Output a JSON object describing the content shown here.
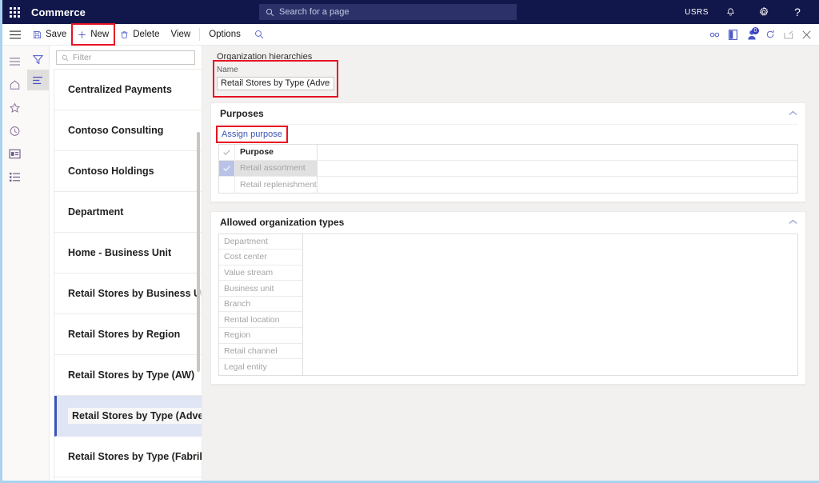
{
  "topbar": {
    "app_name": "Commerce",
    "search_placeholder": "Search for a page",
    "search_value": "",
    "waffle_icon": "app-launcher-icon",
    "search_icon": "search-icon",
    "user_initials": "USRS",
    "notifications_icon": "bell-icon",
    "settings_icon": "gear-icon",
    "help_icon": "help-icon"
  },
  "commandbar": {
    "menu_icon": "hamburger-menu-icon",
    "items": [
      {
        "label": "Save",
        "icon": "save-icon",
        "highlighted": false
      },
      {
        "label": "New",
        "icon": "plus-icon",
        "highlighted": true
      },
      {
        "label": "Delete",
        "icon": "trash-icon",
        "highlighted": false
      },
      {
        "label": "View",
        "icon": "",
        "highlighted": false
      },
      {
        "label": "Options",
        "icon": "",
        "highlighted": false
      }
    ],
    "search_icon": "search-icon",
    "right_icons": [
      {
        "name": "attach-link-icon",
        "badge": ""
      },
      {
        "name": "office-app-icon",
        "badge": ""
      },
      {
        "name": "user-presence-icon",
        "badge": "0"
      },
      {
        "name": "refresh-icon",
        "badge": ""
      },
      {
        "name": "popout-icon",
        "badge": ""
      },
      {
        "name": "close-icon",
        "badge": ""
      }
    ]
  },
  "rail": {
    "items": [
      {
        "name": "navigation-menu-icon",
        "selected": false
      },
      {
        "name": "home-icon",
        "selected": false
      },
      {
        "name": "favorites-star-icon",
        "selected": false
      },
      {
        "name": "recent-clock-icon",
        "selected": false
      },
      {
        "name": "workspaces-icon",
        "selected": false
      },
      {
        "name": "modules-list-icon",
        "selected": false
      }
    ],
    "filter_rail": [
      {
        "name": "filter-funnel-icon",
        "selected": false
      },
      {
        "name": "list-view-icon",
        "selected": true
      }
    ]
  },
  "listpane": {
    "filter_placeholder": "Filter",
    "filter_value": "",
    "filter_icon": "search-icon",
    "items": [
      {
        "label": "Centralized Payments",
        "selected": false
      },
      {
        "label": "Contoso Consulting",
        "selected": false
      },
      {
        "label": "Contoso Holdings",
        "selected": false
      },
      {
        "label": "Department",
        "selected": false
      },
      {
        "label": "Home - Business Unit",
        "selected": false
      },
      {
        "label": "Retail Stores by Business Unit",
        "selected": false
      },
      {
        "label": "Retail Stores by Region",
        "selected": false
      },
      {
        "label": "Retail Stores by Type (AW)",
        "selected": false
      },
      {
        "label": "Retail Stores by Type (Advent",
        "selected": true
      },
      {
        "label": "Retail Stores by Type (Fabrik..",
        "selected": false
      }
    ]
  },
  "main": {
    "breadcrumb": "Organization hierarchies",
    "name_label": "Name",
    "name_value": "Retail Stores by Type (Adventur...",
    "name_highlighted": true,
    "purposes": {
      "title": "Purposes",
      "collapse_icon": "chevron-up-icon",
      "assign_label": "Assign purpose",
      "assign_highlighted": true,
      "header_check_icon": "checkmark-icon",
      "columns": [
        "",
        "Purpose"
      ],
      "rows": [
        {
          "checked": true,
          "label": "Retail assortment",
          "selected": true
        },
        {
          "checked": false,
          "label": "Retail replenishment",
          "selected": false
        }
      ]
    },
    "allowed_types": {
      "title": "Allowed organization types",
      "collapse_icon": "chevron-up-icon",
      "rows": [
        "Department",
        "Cost center",
        "Value stream",
        "Business unit",
        "Branch",
        "Rental location",
        "Region",
        "Retail channel",
        "Legal entity"
      ]
    }
  },
  "colors": {
    "topbar_bg": "#12174b",
    "accent_link": "#3b55b5",
    "highlight_box": "#e81123",
    "page_bg": "#f2f1f0",
    "selection_bg": "#dfe5f5",
    "page_border": "#a9d3ef"
  }
}
